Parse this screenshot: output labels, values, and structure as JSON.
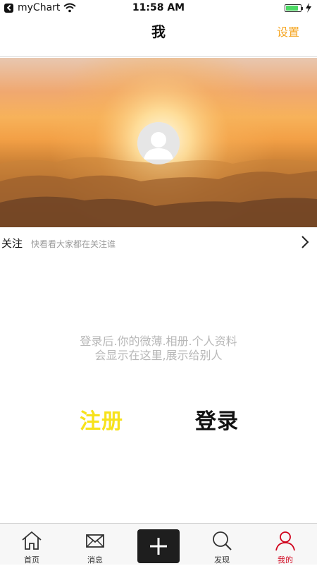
{
  "status_bar": {
    "app_name": "myChart",
    "time": "11:58 AM",
    "battery_level": 0.85
  },
  "nav": {
    "title": "我",
    "settings_label": "设置"
  },
  "follow": {
    "title": "关注",
    "subtitle": "快看看大家都在关注谁"
  },
  "empty_message": {
    "line1": "登录后.你的微薄.相册.个人资料",
    "line2": "会显示在这里,展示给别人"
  },
  "actions": {
    "register_label": "注册",
    "login_label": "登录"
  },
  "tabs": [
    {
      "label": "首页",
      "icon": "home-icon"
    },
    {
      "label": "消息",
      "icon": "envelope-icon"
    },
    {
      "label": "",
      "icon": "plus-icon"
    },
    {
      "label": "发现",
      "icon": "search-icon"
    },
    {
      "label": "我的",
      "icon": "person-icon",
      "active": true
    }
  ],
  "colors": {
    "accent_settings": "#f5a623",
    "register": "#f7e21b",
    "tab_active": "#d0021b"
  }
}
